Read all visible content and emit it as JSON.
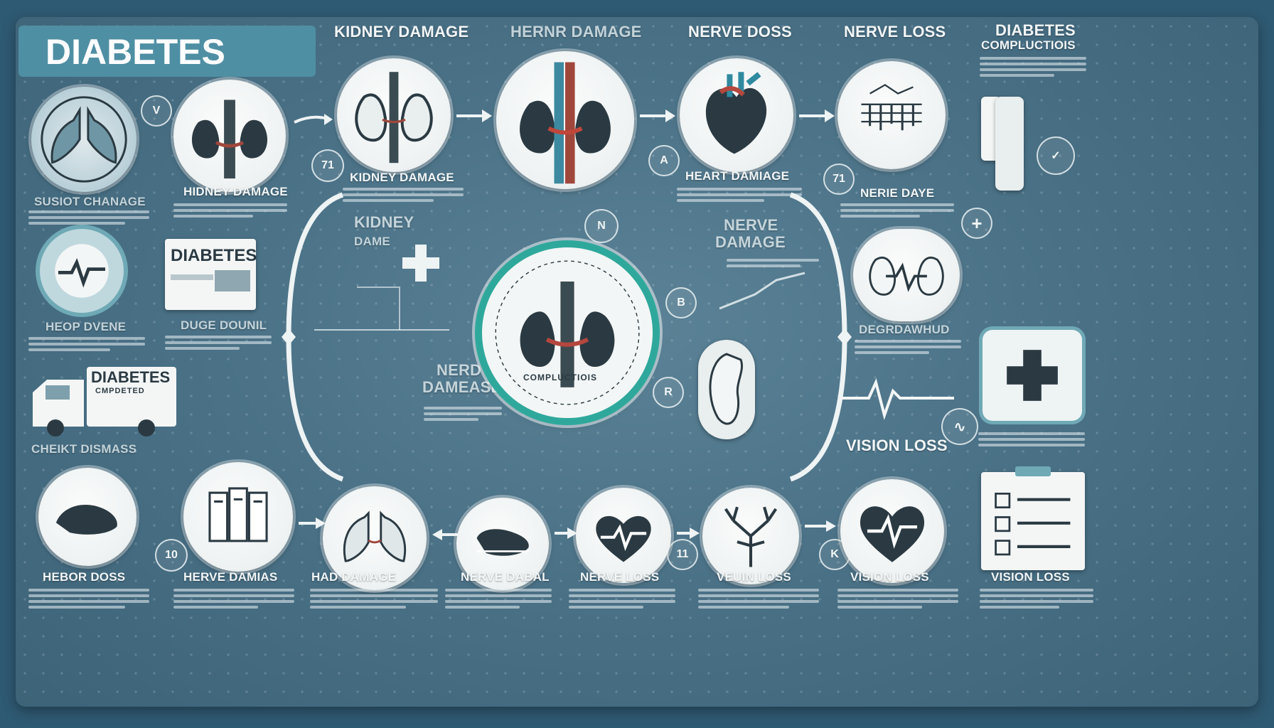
{
  "title": "DIABETES",
  "top_headers": [
    "KIDNEY DAMAGE",
    "HERNR DAMAGE",
    "NERVE DOSS",
    "NERVE LOSS",
    "DIABETES",
    "COMPLUCTIOIS"
  ],
  "row1_labels": [
    "SUSIOT CHANAGE",
    "HIDNEY DAMAGE",
    "KIDNEY DAMAGE",
    "HEART DAMIAGE",
    "NERIE DAYE"
  ],
  "center": {
    "left_label_1": "KIDNEY",
    "left_label_2": "DAME",
    "right_label_1": "NERVE",
    "right_label_2": "DAMAGE",
    "bottom_left_1": "NERDT",
    "bottom_left_2": "DAMEASE",
    "ring_text": "COMPLUCTIOIS"
  },
  "left_cards": {
    "diabetes_card": "DIABETES",
    "truck_line1": "DIABETES",
    "truck_line2": "CMPDETED",
    "hear_label": "HEOP DVENE",
    "duge_label": "DUGE DOUNIL",
    "heart_disease": "CHEIKT DISMASS"
  },
  "right_side": {
    "vision_loss": "VISION LOSS",
    "right_label": "DEGRDAWHUD"
  },
  "bottom_labels": [
    "HEBOR DOSS",
    "HERVE DAMIAS",
    "HAD DAMAGE",
    "NERVE DABAL",
    "NERVE LOSS",
    "VEUIN LOSS",
    "VISION LOSS",
    "VISION LOSS"
  ],
  "small_badges": [
    "71",
    "V",
    "A",
    "B",
    "R",
    "N",
    "11",
    "10",
    "K",
    "71"
  ],
  "colors": {
    "background": "#2f5a73",
    "board": "#4b7287",
    "accent": "#2fa89c",
    "title_box": "#4f8fa3",
    "ink": "#2b3a42"
  }
}
